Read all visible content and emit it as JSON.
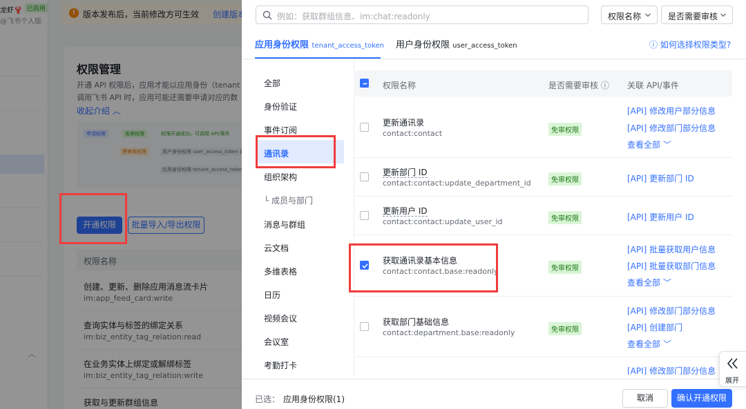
{
  "background": {
    "app_name": "龙虾🦞",
    "app_status": "已启用",
    "app_sub": "@飞书个人版",
    "notice_text": "版本发布后，当前修改方可生效",
    "notice_link": "创建版本",
    "title": "权限管理",
    "desc_line1": "开通 API 权限后，应用才能以应用身份（tenant",
    "desc_line2": "调用飞书 API 时，应用可能还需要申请对应的数",
    "collapse_label": "收起介绍",
    "diagram": {
      "apply": "申请权限",
      "free": "免审权限",
      "success": "权限开通成功，可调用 API/事件",
      "review": "需审核权限",
      "user_identity": "用户身份权限",
      "user_token": "user_access_token 调用",
      "app_identity": "应用身份权限",
      "app_token": "tenant_access_token 调用"
    },
    "open_button": "开通权限",
    "batch_button": "批量导入/导出权限",
    "table_header": "权限名称",
    "rows": [
      {
        "name": "创建、更新、删除应用消息流卡片",
        "code": "im:app_feed_card:write"
      },
      {
        "name": "查询实体与标签的绑定关系",
        "code": "im:biz_entity_tag_relation:read"
      },
      {
        "name": "在业务实体上绑定或解绑标签",
        "code": "im:biz_entity_tag_relation:write"
      },
      {
        "name": "获取与更新群组信息",
        "code": ""
      }
    ]
  },
  "drawer": {
    "search_placeholder": "例如：获取群组信息、im:chat:readonly",
    "filter1": "权限名称",
    "filter2": "是否需要审核",
    "tabs": [
      {
        "label": "应用身份权限",
        "sub": "tenant_access_token"
      },
      {
        "label": "用户身份权限",
        "sub": "user_access_token"
      }
    ],
    "help_link": "如何选择权限类型?",
    "categories": [
      "全部",
      "身份验证",
      "事件订阅",
      "通讯录",
      "组织架构",
      "└ 成员与部门",
      "消息与群组",
      "云文档",
      "多维表格",
      "日历",
      "视频会议",
      "会议室",
      "考勤打卡"
    ],
    "table": {
      "col_name": "权限名称",
      "col_review": "是否需要审核",
      "col_api": "关联 API/事件"
    },
    "rows": [
      {
        "name": "更新通讯录",
        "code": "contact:contact",
        "badge": "免审权限",
        "apis": [
          "[API] 修改用户部分信息",
          "[API] 修改部门部分信息",
          "查看全部"
        ]
      },
      {
        "name": "更新部门 ID",
        "code": "contact:contact:update_department_id",
        "badge": "免审权限",
        "apis": [
          "[API] 更新部门 ID"
        ]
      },
      {
        "name": "更新用户 ID",
        "code": "contact:contact:update_user_id",
        "badge": "免审权限",
        "apis": [
          "[API] 更新用户 ID"
        ]
      },
      {
        "name": "获取通讯录基本信息",
        "code": "contact:contact.base:readonly",
        "badge": "免审权限",
        "apis": [
          "[API] 批量获取用户信息",
          "[API] 批量获取部门信息",
          "查看全部"
        ]
      },
      {
        "name": "获取部门基础信息",
        "code": "contact:department.base:readonly",
        "badge": "免审权限",
        "apis": [
          "[API] 修改部门部分信息",
          "[API] 创建部门",
          "查看全部"
        ]
      },
      {
        "name": "",
        "code": "",
        "badge": "",
        "apis": [
          "[API] 修改部门部分信息"
        ]
      }
    ],
    "footer": {
      "selected_label": "已选：",
      "selected_value": "应用身份权限(1)",
      "cancel": "取消",
      "confirm": "确认开通权限"
    },
    "expand_label": "展开"
  },
  "colors": {
    "accent": "#3370ff",
    "highlight_box": "#f03c3c",
    "badge_bg": "#d9f5d6"
  }
}
